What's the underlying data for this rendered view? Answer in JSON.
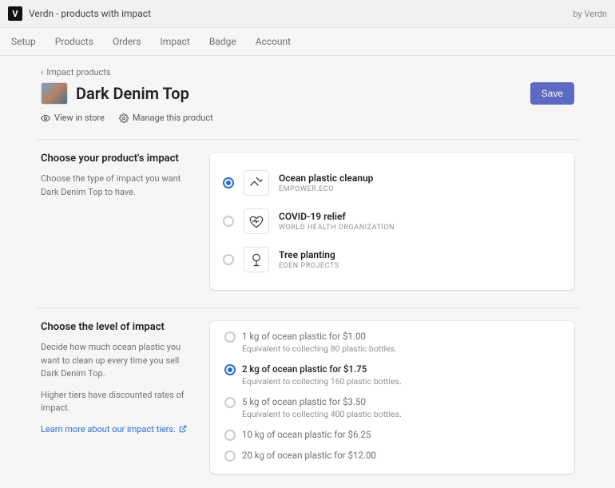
{
  "topbar": {
    "app_title": "Verdn - products with impact",
    "by": "by Verdn"
  },
  "tabs": [
    "Setup",
    "Products",
    "Orders",
    "Impact",
    "Badge",
    "Account"
  ],
  "back_label": "Impact products",
  "product_title": "Dark Denim Top",
  "save_label": "Save",
  "view_label": "View in store",
  "manage_label": "Manage this product",
  "impact_section": {
    "title": "Choose your product's impact",
    "desc": "Choose the type of impact you want Dark Denim Top to have.",
    "options": [
      {
        "name": "Ocean plastic cleanup",
        "sub": "EMPOWER.ECO",
        "selected": true
      },
      {
        "name": "COVID-19 relief",
        "sub": "WORLD HEALTH ORGANIZATION",
        "selected": false
      },
      {
        "name": "Tree planting",
        "sub": "EDEN PROJECTS",
        "selected": false
      }
    ]
  },
  "level_section": {
    "title": "Choose the level of impact",
    "desc1": "Decide how much ocean plastic you want to clean up every time you sell Dark Denim Top.",
    "desc2": "Higher tiers have discounted rates of impact.",
    "link": "Learn more about our impact tiers.",
    "tiers": [
      {
        "label": "1 kg of ocean plastic for $1.00",
        "eq": "Equivalent to collecting 80 plastic bottles.",
        "selected": false
      },
      {
        "label": "2 kg of ocean plastic for $1.75",
        "eq": "Equivalent to collecting 160 plastic bottles.",
        "selected": true
      },
      {
        "label": "5 kg of ocean plastic for $3.50",
        "eq": "Equivalent to collecting 400 plastic bottles.",
        "selected": false
      },
      {
        "label": "10 kg of ocean plastic for $6.25",
        "eq": "",
        "selected": false
      },
      {
        "label": "20 kg of ocean plastic for $12.00",
        "eq": "",
        "selected": false
      }
    ]
  }
}
